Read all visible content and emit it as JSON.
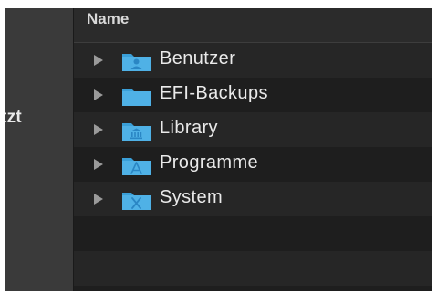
{
  "sidebar": {
    "label": "tzt"
  },
  "list": {
    "header": "Name",
    "items": [
      {
        "label": "Benutzer",
        "icon": "users-folder-icon"
      },
      {
        "label": "EFI-Backups",
        "icon": "folder-icon"
      },
      {
        "label": "Library",
        "icon": "library-folder-icon"
      },
      {
        "label": "Programme",
        "icon": "applications-folder-icon"
      },
      {
        "label": "System",
        "icon": "system-folder-icon"
      }
    ]
  },
  "colors": {
    "folder_blue": "#4fb1e6",
    "folder_tab": "#3a9fd8",
    "folder_glyph": "#2a86c4"
  }
}
